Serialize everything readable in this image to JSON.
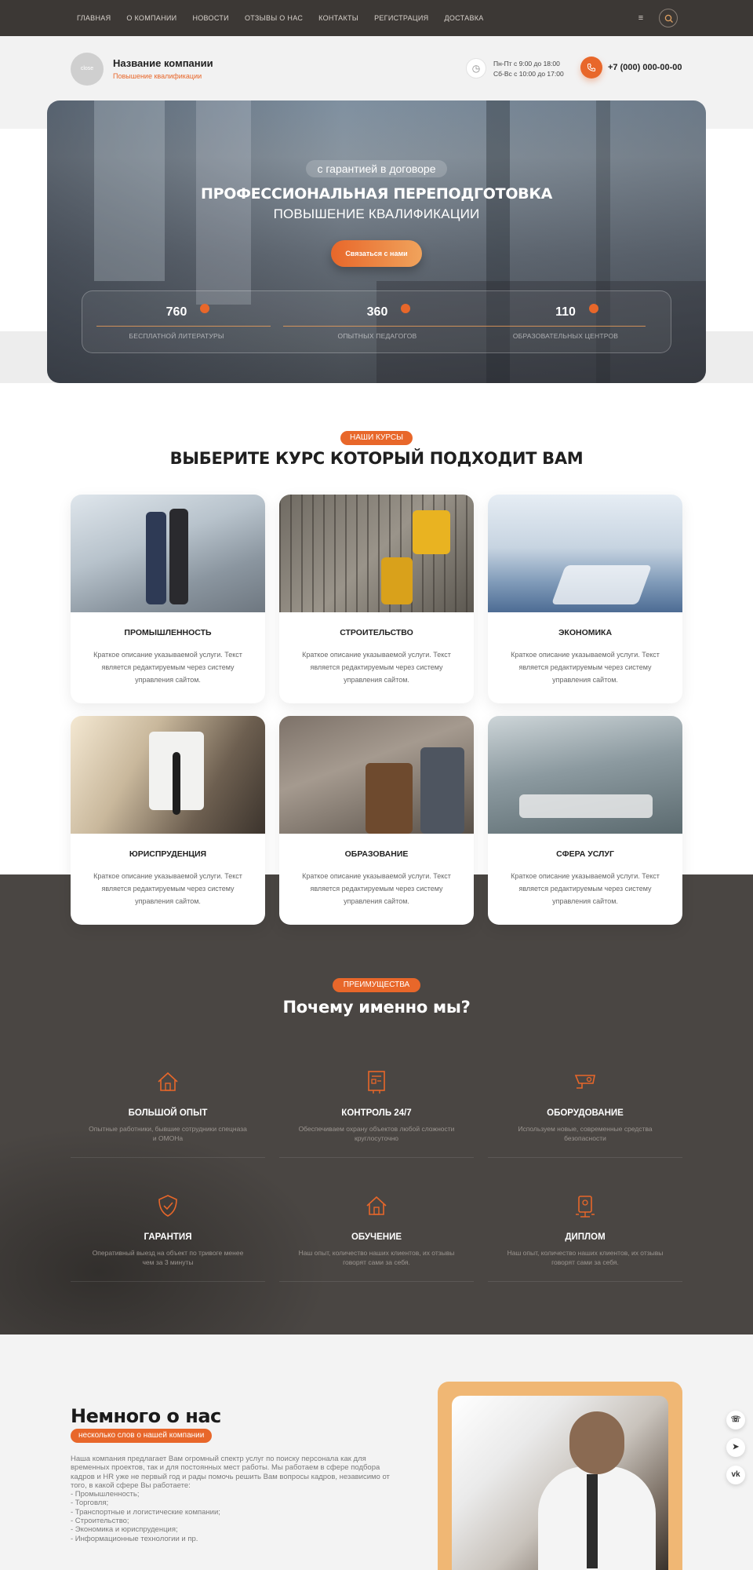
{
  "nav": {
    "items": [
      "ГЛАВНАЯ",
      "О КОМПАНИИ",
      "НОВОСТИ",
      "ОТЗЫВЫ О НАС",
      "КОНТАКТЫ",
      "РЕГИСТРАЦИЯ",
      "ДОСТАВКА"
    ],
    "burger_icon": "menu-icon",
    "search_icon": "search-icon"
  },
  "header": {
    "logo_text": "close",
    "company_name": "Название компании",
    "company_sub": "Повышение квалификации",
    "hours_line1": "Пн-Пт с 9:00 до 18:00",
    "hours_line2": "Сб-Вс с 10:00 до 17:00",
    "phone": "+7 (000) 000-00-00"
  },
  "hero": {
    "tag": "с гарантией в договоре",
    "title": "ПРОФЕССИОНАЛЬНАЯ ПЕРЕПОДГОТОВКА",
    "subtitle": "ПОВЫШЕНИЕ КВАЛИФИКАЦИИ",
    "button": "Связаться с нами",
    "stats": [
      {
        "value": "760",
        "label": "БЕСПЛАТНОЙ ЛИТЕРАТУРЫ"
      },
      {
        "value": "360",
        "label": "ОПЫТНЫХ ПЕДАГОГОВ"
      },
      {
        "value": "110",
        "label": "ОБРАЗОВАТЕЛЬНЫХ ЦЕНТРОВ"
      }
    ]
  },
  "courses": {
    "badge": "НАШИ КУРСЫ",
    "title": "ВЫБЕРИТЕ КУРС КОТОРЫЙ ПОДХОДИТ ВАМ",
    "items": [
      {
        "title": "ПРОМЫШЛЕННОСТЬ",
        "desc": "Краткое описание указываемой услуги. Текст является редактируемым через систему управления сайтом."
      },
      {
        "title": "СТРОИТЕЛЬСТВО",
        "desc": "Краткое описание указываемой услуги. Текст является редактируемым через систему управления сайтом."
      },
      {
        "title": "ЭКОНОМИКА",
        "desc": "Краткое описание указываемой услуги. Текст является редактируемым через систему управления сайтом."
      },
      {
        "title": "ЮРИСПРУДЕНЦИЯ",
        "desc": "Краткое описание указываемой услуги. Текст является редактируемым через систему управления сайтом."
      },
      {
        "title": "ОБРАЗОВАНИЕ",
        "desc": "Краткое описание указываемой услуги. Текст является редактируемым через систему управления сайтом."
      },
      {
        "title": "СФЕРА УСЛУГ",
        "desc": "Краткое описание указываемой услуги. Текст является редактируемым через систему управления сайтом."
      }
    ]
  },
  "advantages": {
    "badge": "ПРЕИМУЩЕСТВА",
    "title": "Почему именно мы?",
    "items": [
      {
        "title": "БОЛЬШОЙ ОПЫТ",
        "desc": "Опытные работники, бывшие сотрудники спецназа и ОМОНа",
        "icon": "house-icon"
      },
      {
        "title": "КОНТРОЛЬ 24/7",
        "desc": "Обеспечиваем охрану объектов любой сложности круглосуточно",
        "icon": "monitor-icon"
      },
      {
        "title": "ОБОРУДОВАНИЕ",
        "desc": "Используем новые, современные средства безопасности",
        "icon": "camera-icon"
      },
      {
        "title": "ГАРАНТИЯ",
        "desc": "Оперативный выезд на объект по тривоге менее чем за 3 минуты",
        "icon": "shield-icon"
      },
      {
        "title": "ОБУЧЕНИЕ",
        "desc": "Наш опыт, количество наших клиентов, их отзывы говорят сами за себя.",
        "icon": "house-icon"
      },
      {
        "title": "ДИПЛОМ",
        "desc": "Наш опыт, количество наших клиентов, их отзывы говорят сами за себя.",
        "icon": "diploma-icon"
      }
    ]
  },
  "about": {
    "title": "Немного о нас",
    "badge": "несколько слов о нашей компании",
    "lines": [
      "Наша компания предлагает Вам огромный спектр услуг по поиску персонала как для",
      "временных проектов, так и для постоянных мест работы. Мы работаем в сфере подбора",
      "кадров и HR уже не первый год и рады помочь решить Вам вопросы кадров, независимо от",
      "того, в какой сфере Вы работаете:",
      "- Промышленность;",
      "- Торговля;",
      "- Транспортные и логистические компании;",
      "- Строительство;",
      "- Экономика и юриспруденция;",
      "- Информационные технологии и пр."
    ]
  },
  "social": {
    "items": [
      "whatsapp-icon",
      "telegram-icon",
      "vk-icon"
    ],
    "vk_label": "vk"
  },
  "colors": {
    "accent": "#e8672a",
    "dark": "#4a4643",
    "nav": "#3c3835"
  }
}
